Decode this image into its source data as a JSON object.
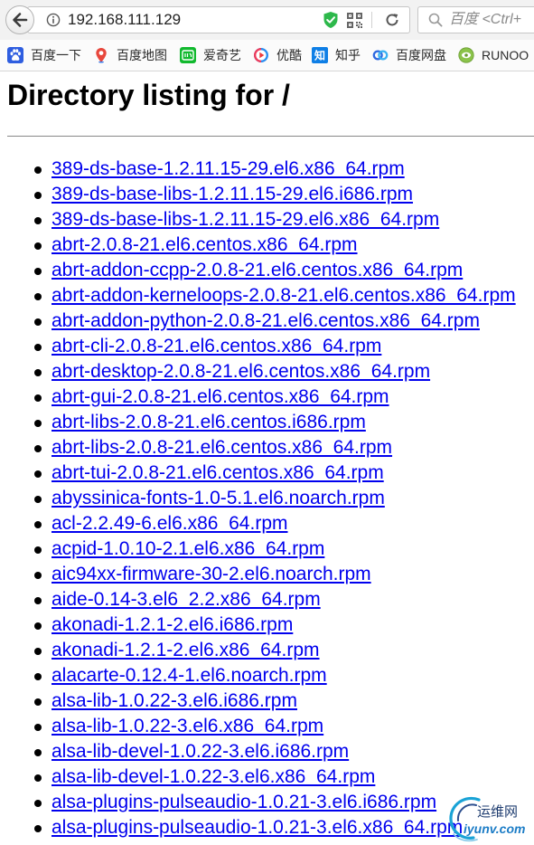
{
  "browser": {
    "toolbar_icons": [
      "back-arrow-icon",
      "info-icon",
      "security-shield-icon",
      "qr-code-icon",
      "refresh-icon",
      "search-icon"
    ],
    "address": {
      "url": "192.168.111.129"
    },
    "search": {
      "placeholder": "百度 <Ctrl+"
    },
    "bookmarks": [
      {
        "label": "百度一下",
        "icon": "baidu-paw-icon"
      },
      {
        "label": "百度地图",
        "icon": "baidu-map-pin-icon"
      },
      {
        "label": "爱奇艺",
        "icon": "iqiyi-icon"
      },
      {
        "label": "优酷",
        "icon": "youku-icon"
      },
      {
        "label": "知乎",
        "icon": "zhihu-icon",
        "glyph": "知"
      },
      {
        "label": "百度网盘",
        "icon": "baidu-netdisk-icon"
      },
      {
        "label": "RUNOO",
        "icon": "runoob-icon"
      }
    ]
  },
  "page": {
    "heading": "Directory listing for /",
    "files": [
      "389-ds-base-1.2.11.15-29.el6.x86_64.rpm",
      "389-ds-base-libs-1.2.11.15-29.el6.i686.rpm",
      "389-ds-base-libs-1.2.11.15-29.el6.x86_64.rpm",
      "abrt-2.0.8-21.el6.centos.x86_64.rpm",
      "abrt-addon-ccpp-2.0.8-21.el6.centos.x86_64.rpm",
      "abrt-addon-kerneloops-2.0.8-21.el6.centos.x86_64.rpm",
      "abrt-addon-python-2.0.8-21.el6.centos.x86_64.rpm",
      "abrt-cli-2.0.8-21.el6.centos.x86_64.rpm",
      "abrt-desktop-2.0.8-21.el6.centos.x86_64.rpm",
      "abrt-gui-2.0.8-21.el6.centos.x86_64.rpm",
      "abrt-libs-2.0.8-21.el6.centos.i686.rpm",
      "abrt-libs-2.0.8-21.el6.centos.x86_64.rpm",
      "abrt-tui-2.0.8-21.el6.centos.x86_64.rpm",
      "abyssinica-fonts-1.0-5.1.el6.noarch.rpm",
      "acl-2.2.49-6.el6.x86_64.rpm",
      "acpid-1.0.10-2.1.el6.x86_64.rpm",
      "aic94xx-firmware-30-2.el6.noarch.rpm",
      "aide-0.14-3.el6_2.2.x86_64.rpm",
      "akonadi-1.2.1-2.el6.i686.rpm",
      "akonadi-1.2.1-2.el6.x86_64.rpm",
      "alacarte-0.12.4-1.el6.noarch.rpm",
      "alsa-lib-1.0.22-3.el6.i686.rpm",
      "alsa-lib-1.0.22-3.el6.x86_64.rpm",
      "alsa-lib-devel-1.0.22-3.el6.i686.rpm",
      "alsa-lib-devel-1.0.22-3.el6.x86_64.rpm",
      "alsa-plugins-pulseaudio-1.0.21-3.el6.i686.rpm",
      "alsa-plugins-pulseaudio-1.0.21-3.el6.x86_64.rpm"
    ]
  },
  "watermark": {
    "title": "运维网",
    "domain": "iyunv.com",
    "icon": "swoosh-logo-icon"
  },
  "colors": {
    "link": "#0000ee",
    "watermark_title": "#1f3d70",
    "watermark_domain": "#1b7cc6"
  }
}
